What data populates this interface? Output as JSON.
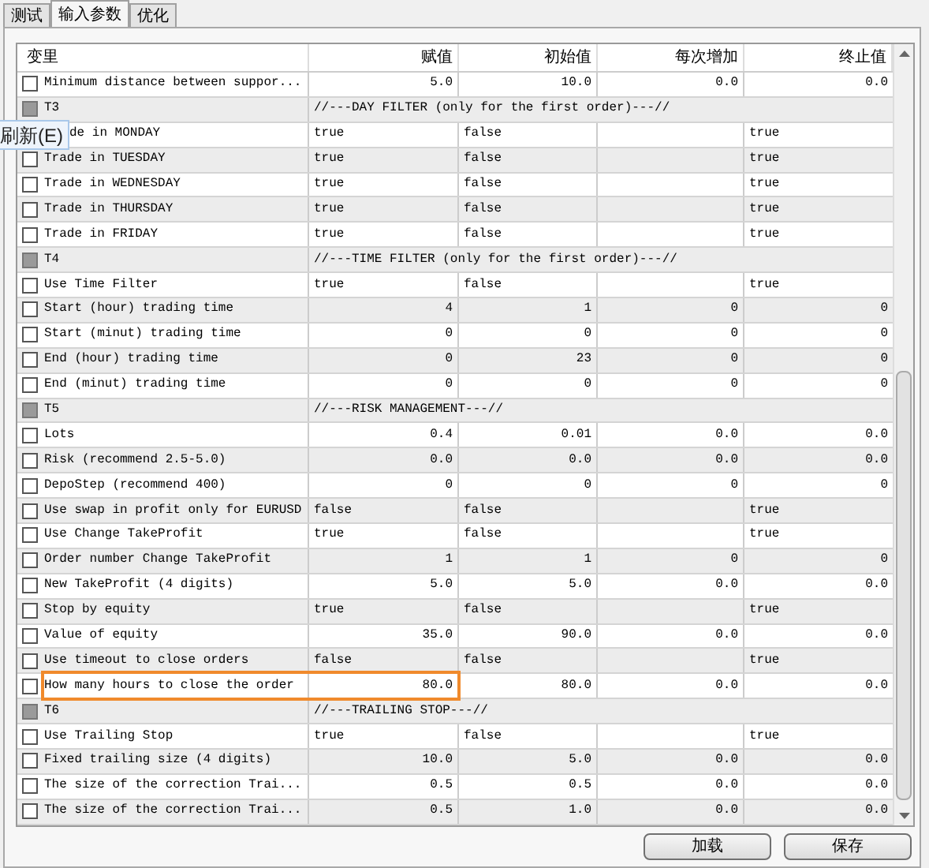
{
  "tabs": [
    {
      "label": "测试",
      "selected": false
    },
    {
      "label": "输入参数",
      "selected": true
    },
    {
      "label": "优化",
      "selected": false
    }
  ],
  "table": {
    "columns": [
      "变里",
      "赋值",
      "初始值",
      "每次增加",
      "终止值"
    ],
    "rows": [
      {
        "kind": "param",
        "checked": false,
        "label": "Minimum distance between suppor...",
        "value": "5.0",
        "start": "10.0",
        "step": "0.0",
        "stop": "0.0"
      },
      {
        "kind": "group",
        "checked": false,
        "label": "T3",
        "comment": "//---DAY FILTER (only for the first order)---//"
      },
      {
        "kind": "param",
        "label": "de in MONDAY",
        "value": "true",
        "start": "false",
        "stop": "true",
        "text_values": true
      },
      {
        "kind": "param",
        "checked": false,
        "label": "Trade in TUESDAY",
        "value": "true",
        "start": "false",
        "stop": "true",
        "text_values": true
      },
      {
        "kind": "param",
        "checked": false,
        "label": "Trade in WEDNESDAY",
        "value": "true",
        "start": "false",
        "stop": "true",
        "text_values": true
      },
      {
        "kind": "param",
        "checked": false,
        "label": "Trade in THURSDAY",
        "value": "true",
        "start": "false",
        "stop": "true",
        "text_values": true
      },
      {
        "kind": "param",
        "checked": false,
        "label": "Trade in FRIDAY",
        "value": "true",
        "start": "false",
        "stop": "true",
        "text_values": true
      },
      {
        "kind": "group",
        "checked": false,
        "label": "T4",
        "comment": "//---TIME FILTER (only for the first order)---//"
      },
      {
        "kind": "param",
        "checked": false,
        "label": "Use Time Filter",
        "value": "true",
        "start": "false",
        "stop": "true",
        "text_values": true
      },
      {
        "kind": "param",
        "checked": false,
        "label": "Start (hour) trading time",
        "value": "4",
        "start": "1",
        "step": "0",
        "stop": "0"
      },
      {
        "kind": "param",
        "checked": false,
        "label": "Start (minut) trading time",
        "value": "0",
        "start": "0",
        "step": "0",
        "stop": "0"
      },
      {
        "kind": "param",
        "checked": false,
        "label": "End (hour) trading time",
        "value": "0",
        "start": "23",
        "step": "0",
        "stop": "0"
      },
      {
        "kind": "param",
        "checked": false,
        "label": "End (minut) trading time",
        "value": "0",
        "start": "0",
        "step": "0",
        "stop": "0"
      },
      {
        "kind": "group",
        "checked": false,
        "label": "T5",
        "comment": "//---RISK MANAGEMENT---//"
      },
      {
        "kind": "param",
        "checked": false,
        "label": "Lots",
        "value": "0.4",
        "start": "0.01",
        "step": "0.0",
        "stop": "0.0"
      },
      {
        "kind": "param",
        "checked": false,
        "label": "Risk (recommend 2.5-5.0)",
        "value": "0.0",
        "start": "0.0",
        "step": "0.0",
        "stop": "0.0"
      },
      {
        "kind": "param",
        "checked": false,
        "label": "DepoStep (recommend 400)",
        "value": "0",
        "start": "0",
        "step": "0",
        "stop": "0"
      },
      {
        "kind": "param",
        "checked": false,
        "label": "Use swap in profit only for EURUSD",
        "value": "false",
        "start": "false",
        "stop": "true",
        "text_values": true
      },
      {
        "kind": "param",
        "checked": false,
        "label": "Use Change TakeProfit",
        "value": "true",
        "start": "false",
        "stop": "true",
        "text_values": true
      },
      {
        "kind": "param",
        "checked": false,
        "label": "Order number Change TakeProfit",
        "value": "1",
        "start": "1",
        "step": "0",
        "stop": "0"
      },
      {
        "kind": "param",
        "checked": false,
        "label": "New TakeProfit (4 digits)",
        "value": "5.0",
        "start": "5.0",
        "step": "0.0",
        "stop": "0.0"
      },
      {
        "kind": "param",
        "checked": false,
        "label": "Stop by equity",
        "value": "true",
        "start": "false",
        "stop": "true",
        "text_values": true
      },
      {
        "kind": "param",
        "checked": false,
        "label": "Value of equity",
        "value": "35.0",
        "start": "90.0",
        "step": "0.0",
        "stop": "0.0"
      },
      {
        "kind": "param",
        "checked": false,
        "label": "Use timeout to close orders",
        "value": "false",
        "start": "false",
        "stop": "true",
        "text_values": true
      },
      {
        "kind": "param",
        "checked": false,
        "label": "How many hours to close the order",
        "value": "80.0",
        "start": "80.0",
        "step": "0.0",
        "stop": "0.0",
        "highlighted": true
      },
      {
        "kind": "group",
        "checked": false,
        "label": "T6",
        "comment": "//---TRAILING STOP---//"
      },
      {
        "kind": "param",
        "checked": false,
        "label": "Use Trailing Stop",
        "value": "true",
        "start": "false",
        "stop": "true",
        "text_values": true
      },
      {
        "kind": "param",
        "checked": false,
        "label": "Fixed trailing size (4 digits)",
        "value": "10.0",
        "start": "5.0",
        "step": "0.0",
        "stop": "0.0"
      },
      {
        "kind": "param",
        "checked": false,
        "label": "The size of the correction Trai...",
        "value": "0.5",
        "start": "0.5",
        "step": "0.0",
        "stop": "0.0"
      },
      {
        "kind": "param",
        "checked": false,
        "label": "The size of the correction Trai...",
        "value": "0.5",
        "start": "1.0",
        "step": "0.0",
        "stop": "0.0"
      }
    ]
  },
  "context_menu": {
    "item": "刷新(E)"
  },
  "buttons": [
    "加载",
    "保存"
  ]
}
